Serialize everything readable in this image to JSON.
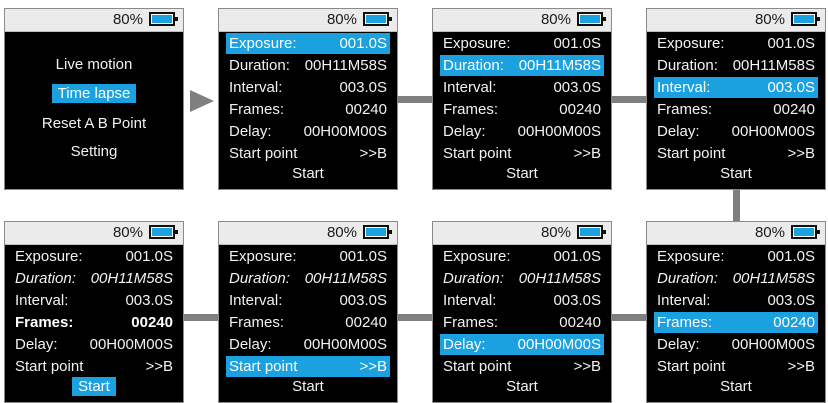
{
  "battery_percent": "80%",
  "menu": {
    "items": [
      {
        "label": "Live motion"
      },
      {
        "label": "Time lapse"
      },
      {
        "label": "Reset A B Point"
      },
      {
        "label": "Setting"
      }
    ],
    "selected": "Time lapse"
  },
  "settings": {
    "exposure": {
      "label": "Exposure:",
      "value": "001.0S"
    },
    "duration": {
      "label": "Duration:",
      "value": "00H11M58S"
    },
    "interval": {
      "label": "Interval:",
      "value": "003.0S"
    },
    "frames": {
      "label": "Frames:",
      "value": "00240"
    },
    "delay": {
      "label": "Delay:",
      "value": "00H00M00S"
    },
    "start_point": {
      "label": "Start point",
      "value": ">>B"
    },
    "start": {
      "label": "Start"
    }
  },
  "screens": [
    {
      "type": "menu",
      "highlight": "Time lapse"
    },
    {
      "type": "settings",
      "highlight": "exposure"
    },
    {
      "type": "settings",
      "highlight": "duration"
    },
    {
      "type": "settings",
      "highlight": "interval"
    },
    {
      "type": "settings",
      "highlight": "frames"
    },
    {
      "type": "settings",
      "highlight": "delay"
    },
    {
      "type": "settings",
      "highlight": "start_point"
    },
    {
      "type": "settings",
      "highlight": "start"
    }
  ],
  "colors": {
    "highlight": "#1ba0e0",
    "screen_bg": "#000000",
    "connector": "#7f7f7f"
  }
}
